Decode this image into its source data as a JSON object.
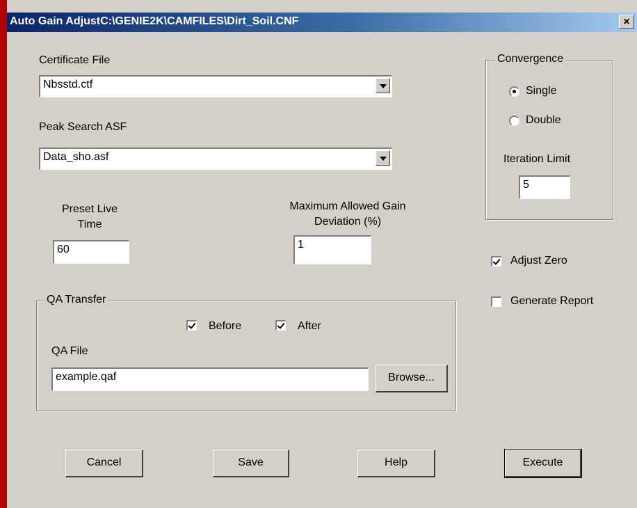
{
  "window": {
    "title": "Auto Gain AdjustC:\\GENIE2K\\CAMFILES\\Dirt_Soil.CNF",
    "close_glyph": "×"
  },
  "certificate": {
    "label": "Certificate File",
    "value": "Nbsstd.ctf"
  },
  "peak_search": {
    "label": "Peak Search ASF",
    "value": "Data_sho.asf"
  },
  "preset": {
    "label_line1": "Preset Live",
    "label_line2": "Time",
    "value": "60"
  },
  "max_gain": {
    "label_line1": "Maximum Allowed Gain",
    "label_line2": "Deviation (%)",
    "value": "1"
  },
  "convergence": {
    "legend": "Convergence",
    "options": [
      {
        "label": "Single",
        "selected": true
      },
      {
        "label": "Double",
        "selected": false
      }
    ],
    "iteration_label": "Iteration Limit",
    "iteration_value": "5"
  },
  "adjust_zero": {
    "label": "Adjust Zero",
    "checked": true
  },
  "generate_report": {
    "label": "Generate Report",
    "checked": false
  },
  "qa": {
    "legend": "QA Transfer",
    "before": {
      "label": "Before",
      "checked": true
    },
    "after": {
      "label": "After",
      "checked": true
    },
    "file_label": "QA File",
    "file_value": "example.qaf",
    "browse_label": "Browse..."
  },
  "buttons": {
    "cancel": "Cancel",
    "save": "Save",
    "help": "Help",
    "execute": "Execute"
  }
}
